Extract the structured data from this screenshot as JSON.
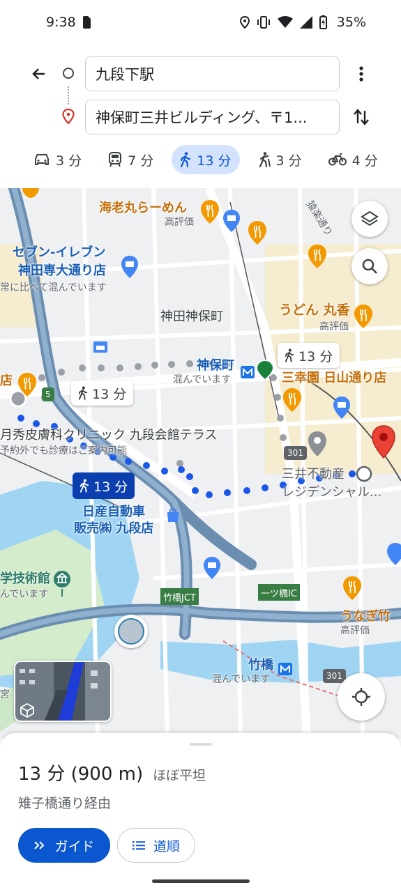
{
  "status": {
    "time": "9:38",
    "battery": "35%"
  },
  "search": {
    "origin": "九段下駅",
    "destination": "神保町三井ビルディング、〒1..."
  },
  "modes": [
    {
      "icon": "car-icon",
      "label": "3 分"
    },
    {
      "icon": "train-icon",
      "label": "7 分"
    },
    {
      "icon": "walk-icon",
      "label": "13 分"
    },
    {
      "icon": "ride-icon",
      "label": "3 分"
    },
    {
      "icon": "bike-icon",
      "label": "4 分"
    }
  ],
  "map": {
    "labels": {
      "ebimaru": "海老丸らーめん",
      "ebimaru_sub": "高評価",
      "seven": "セブン-イレブン",
      "seven2": "神田専大通り店",
      "seven_sub": "常に比べて混んでいます",
      "jimbocho_area": "神田神保町",
      "udon": "うどん 丸香",
      "udon_sub": "高評価",
      "jimbocho_station": "神保町",
      "jimbocho_station_sub": "混んでいます",
      "sankoen": "三幸園 日山通り店",
      "clinic": "月秀皮膚科クリニック 九段会館テラス",
      "clinic_sub": "予約外でも診療はご案内可能",
      "mitsui": "三井不動産",
      "mitsui2": "レジデンシャル...",
      "nissan": "日産自動車",
      "nissan2": "販売㈱ 九段店",
      "museum": "学技術館",
      "museum_sub": "んでいます",
      "takebashi_jct": "竹橋JCT",
      "hitotsubashi": "一ツ橋IC",
      "unagi": "うなぎ竹",
      "unagi_sub": "高評価",
      "takebashi": "竹橋",
      "takebashi_sub": "混んでいます",
      "ten": "店",
      "miya": "宮",
      "road_sarugaku": "猿楽通り",
      "route5": "5",
      "route301a": "301",
      "route301b": "301"
    },
    "chips": {
      "alt1": "13 分",
      "alt2": "13 分",
      "selected": "13 分"
    }
  },
  "sheet": {
    "duration": "13 分 (900 m)",
    "terrain": "ほぼ平坦",
    "via": "雉子橋通り経由",
    "guide_button": "ガイド",
    "steps_button": "道順"
  },
  "colors": {
    "accent": "#0b57d0",
    "route": "#1a57e8",
    "selected_chip": "#0b3fb0",
    "poi_food": "#f29900",
    "poi_blue": "#4285f4"
  }
}
